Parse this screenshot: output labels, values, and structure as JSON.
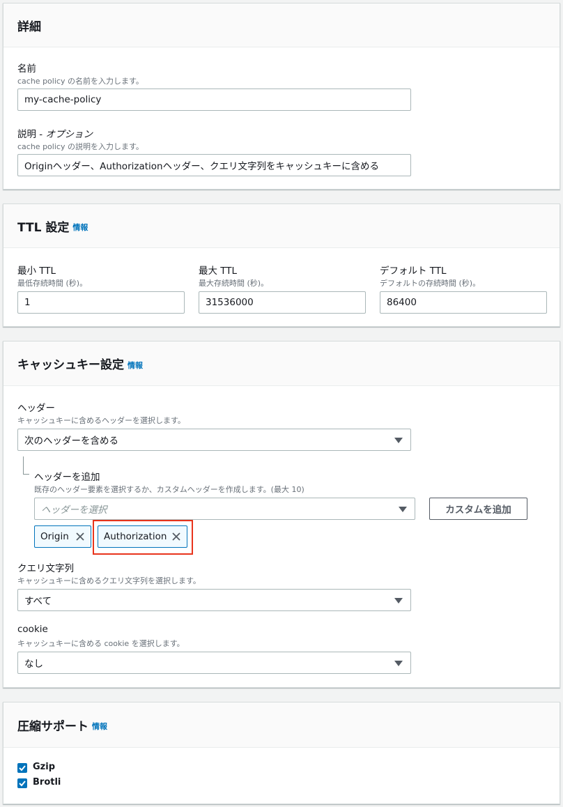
{
  "details": {
    "title": "詳細",
    "name_label": "名前",
    "name_desc": "cache policy の名前を入力します。",
    "name_value": "my-cache-policy",
    "desc_label": "説明 - ",
    "desc_label_optional": "オプション",
    "desc_desc": "cache policy の説明を入力します。",
    "desc_value": "Originヘッダー、Authorizationヘッダー、クエリ文字列をキャッシュキーに含める"
  },
  "ttl": {
    "title": "TTL 設定",
    "info": "情報",
    "min_label": "最小 TTL",
    "min_desc": "最低存続時間 (秒)。",
    "min_value": "1",
    "max_label": "最大 TTL",
    "max_desc": "最大存続時間 (秒)。",
    "max_value": "31536000",
    "default_label": "デフォルト TTL",
    "default_desc": "デフォルトの存続時間 (秒)。",
    "default_value": "86400"
  },
  "cache_key": {
    "title": "キャッシュキー設定",
    "info": "情報",
    "headers_label": "ヘッダー",
    "headers_desc": "キャッシュキーに含めるヘッダーを選択します。",
    "headers_value": "次のヘッダーを含める",
    "add_header_label": "ヘッダーを追加",
    "add_header_desc": "既存のヘッダー要素を選択するか、カスタムヘッダーを作成します。(最大 10)",
    "header_select_placeholder": "ヘッダーを選択",
    "add_custom_button": "カスタムを追加",
    "tokens": [
      "Origin",
      "Authorization"
    ],
    "query_label": "クエリ文字列",
    "query_desc": "キャッシュキーに含めるクエリ文字列を選択します。",
    "query_value": "すべて",
    "cookie_label": "cookie",
    "cookie_desc": "キャッシュキーに含める cookie を選択します。",
    "cookie_value": "なし"
  },
  "compression": {
    "title": "圧縮サポート",
    "info": "情報",
    "options": [
      {
        "label": "Gzip",
        "checked": true
      },
      {
        "label": "Brotli",
        "checked": true
      }
    ]
  },
  "colors": {
    "accent": "#0073bb",
    "highlight": "#e8341c"
  }
}
